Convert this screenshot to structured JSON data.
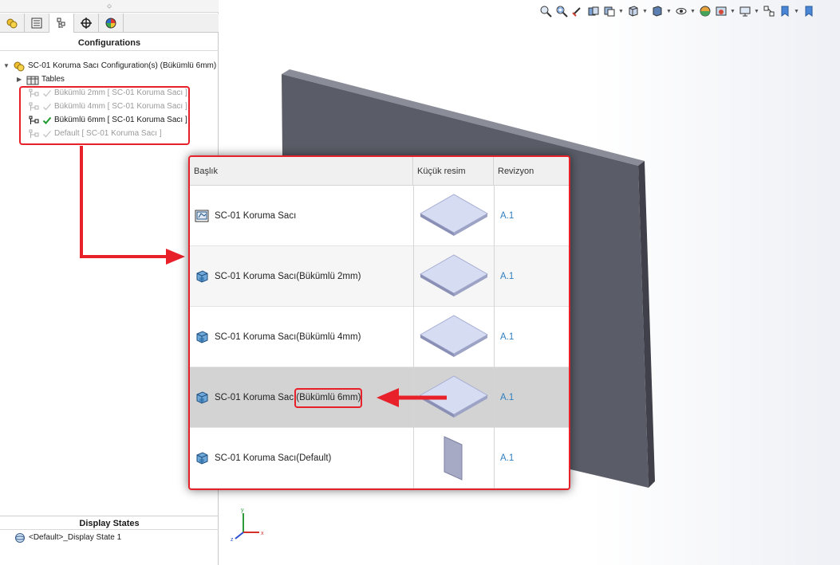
{
  "left_panel": {
    "tabs": [
      {
        "name": "feature-manager",
        "icon": "gear-yellow-icon"
      },
      {
        "name": "property-manager",
        "icon": "list-icon"
      },
      {
        "name": "configuration-manager",
        "icon": "configuration-icon"
      },
      {
        "name": "dimxpert-manager",
        "icon": "crosshair-icon"
      },
      {
        "name": "display-manager",
        "icon": "color-wheel-icon"
      }
    ],
    "configurations_title": "Configurations",
    "root_label": "SC-01 Koruma Sacı Configuration(s)  (Bükümlü 6mm)",
    "tables_label": "Tables",
    "configs": [
      {
        "label": "Bükümlü 2mm [ SC-01 Koruma Sacı ]",
        "active": false
      },
      {
        "label": "Bükümlü 4mm [ SC-01 Koruma Sacı ]",
        "active": false
      },
      {
        "label": "Bükümlü 6mm [ SC-01 Koruma Sacı ]",
        "active": true
      },
      {
        "label": "Default [ SC-01 Koruma Sacı ]",
        "active": false
      }
    ],
    "display_states_title": "Display States",
    "display_state_item": "<Default>_Display State 1"
  },
  "table": {
    "headers": [
      "Başlık",
      "Küçük resim",
      "Revizyon"
    ],
    "rows": [
      {
        "title": "SC-01 Koruma Sacı",
        "icon": "drawing-icon",
        "thumb": "flat",
        "revision": "A.1",
        "highlight": false
      },
      {
        "title": "SC-01 Koruma Sacı(Bükümlü 2mm)",
        "icon": "part-icon",
        "thumb": "flat",
        "revision": "A.1",
        "highlight": false
      },
      {
        "title": "SC-01 Koruma Sacı(Bükümlü 4mm)",
        "icon": "part-icon",
        "thumb": "flat",
        "revision": "A.1",
        "highlight": false
      },
      {
        "title": "SC-01 Koruma Sacı(Bükümlü 6mm)",
        "icon": "part-icon",
        "thumb": "flat",
        "revision": "A.1",
        "highlight": true
      },
      {
        "title": "SC-01 Koruma Sacı(Default)",
        "icon": "part-icon",
        "thumb": "vertical",
        "revision": "A.1",
        "highlight": false
      }
    ]
  },
  "triad": {
    "x": "x",
    "y": "y",
    "z": "z"
  },
  "colors": {
    "annotation": "#e8202a",
    "revision_link": "#2f7fc1",
    "highlight_row": "#d3d3d3",
    "part": "#55575f"
  }
}
